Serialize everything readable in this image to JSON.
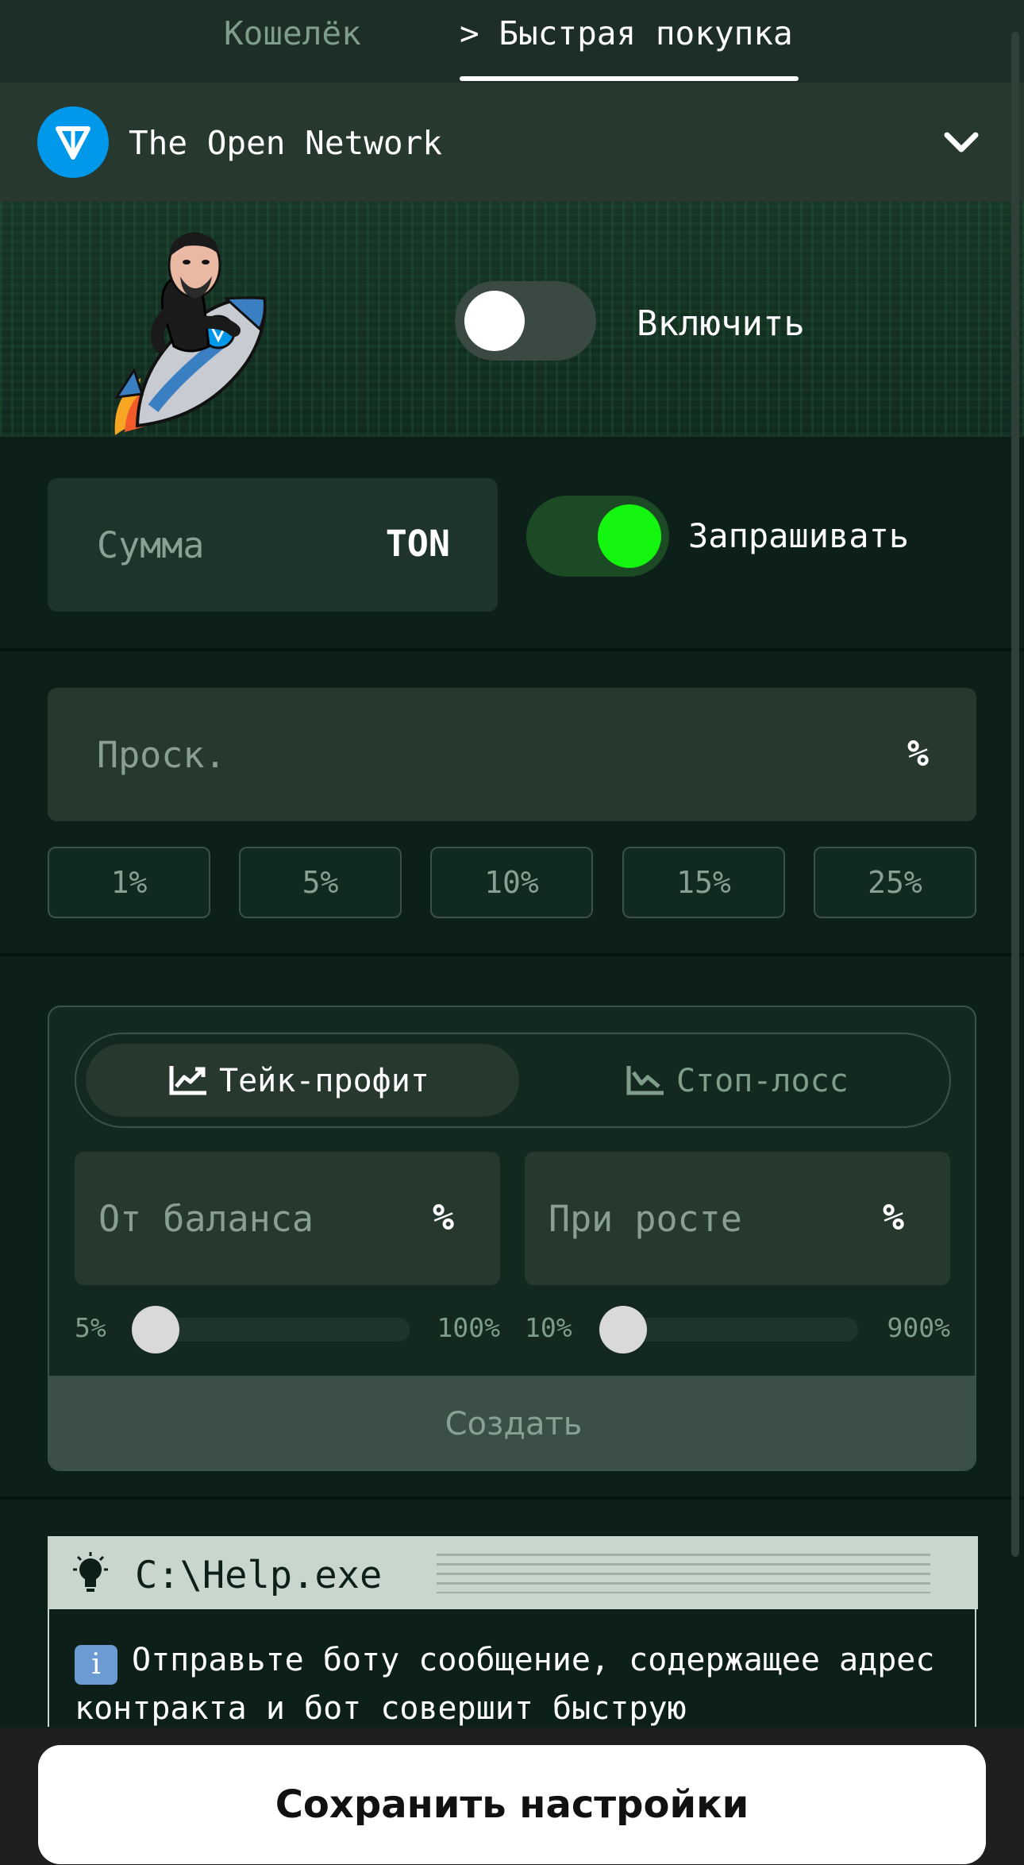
{
  "tabs": {
    "wallet": "Кошелёк",
    "fast_buy": "> Быстрая покупка"
  },
  "network": {
    "name": "The Open Network",
    "icon": "ton-logo-icon",
    "dropdown_icon": "chevron-down-icon"
  },
  "hero": {
    "enable_label": "Включить",
    "enable_on": false
  },
  "amount": {
    "placeholder": "Сумма",
    "unit": "TON",
    "ask_label": "Запрашивать",
    "ask_on": true
  },
  "slippage": {
    "placeholder": "Проск.",
    "unit": "%",
    "presets": [
      "1%",
      "5%",
      "10%",
      "15%",
      "25%"
    ]
  },
  "tpsl": {
    "tabs": {
      "take_profit": "Тейк-профит",
      "stop_loss": "Стоп-лосс",
      "active": "take_profit"
    },
    "balance_field": {
      "placeholder": "От баланса",
      "unit": "%"
    },
    "growth_field": {
      "placeholder": "При росте",
      "unit": "%"
    },
    "balance_slider": {
      "min_label": "5%",
      "max_label": "100%",
      "value": 5
    },
    "growth_slider": {
      "min_label": "10%",
      "max_label": "900%",
      "value": 10
    },
    "create_label": "Создать"
  },
  "help": {
    "title": "C:\\Help.exe",
    "info_glyph": "i",
    "text": "Отправьте боту сообщение, содержащее адрес контракта и бот совершит быструю"
  },
  "save_label": "Сохранить настройки",
  "colors": {
    "background": "#0c2019",
    "accent_green": "#14f50f",
    "ton_blue": "#0098ea"
  }
}
